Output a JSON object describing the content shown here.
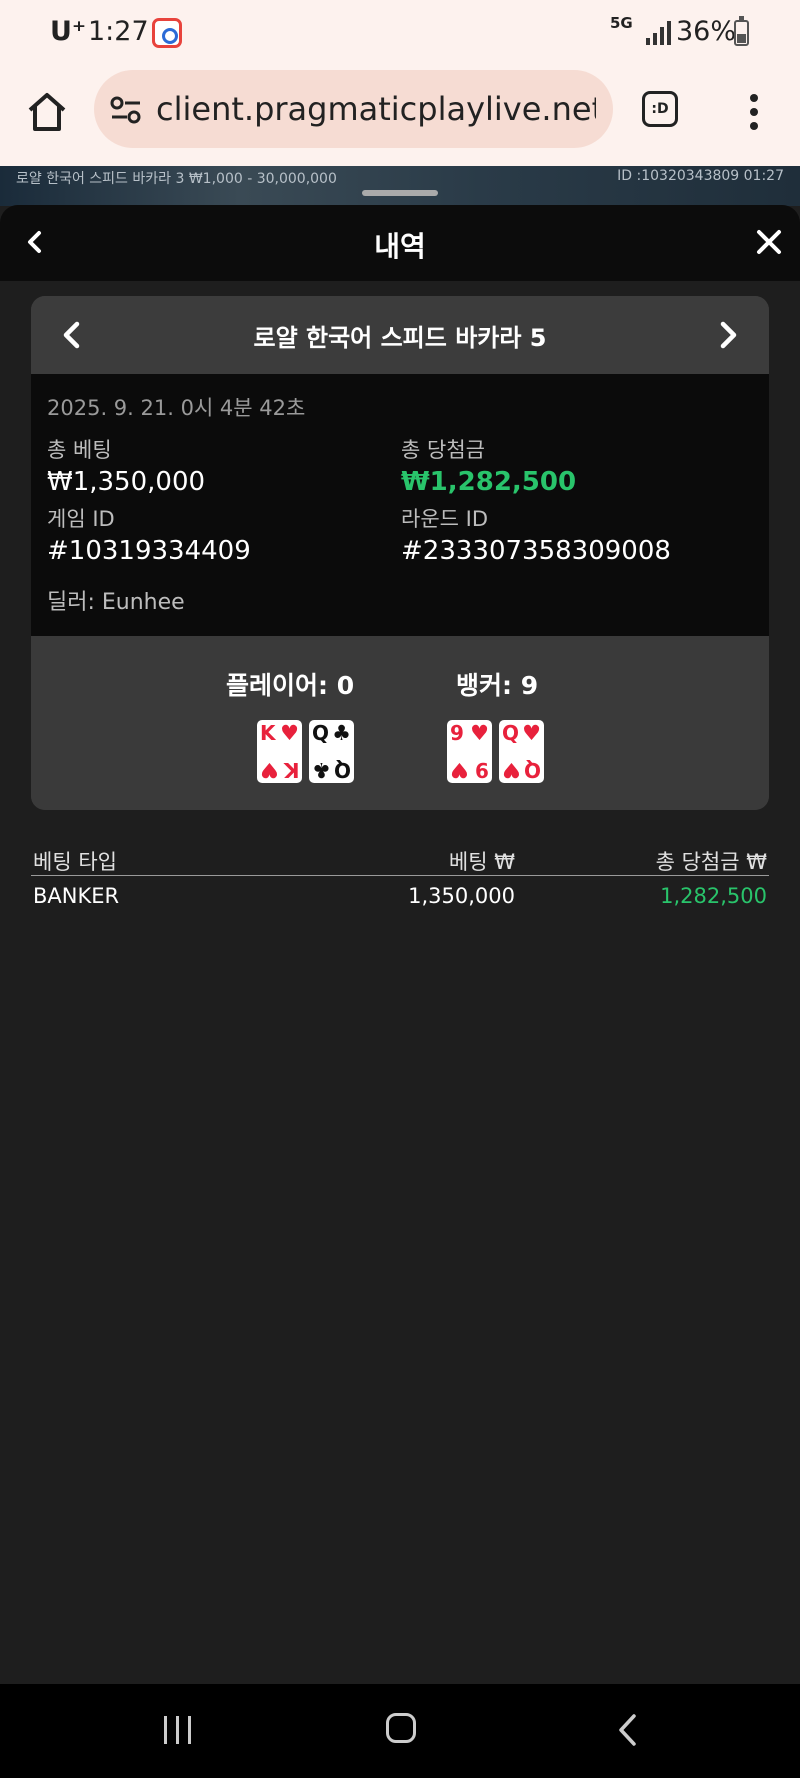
{
  "status_bar": {
    "carrier": "U⁺",
    "time": "1:27",
    "network": "5G",
    "battery": "36%"
  },
  "browser": {
    "url": "client.pragmaticplaylive.net/c",
    "tabs_label": ":D"
  },
  "background_game": {
    "table_text": "로얄 한국어 스피드 바카라 3 ₩1,000 - 30,000,000",
    "id_text": "ID :10320343809 01:27"
  },
  "sheet": {
    "title": "내역"
  },
  "round": {
    "table_name": "로얄 한국어 스피드 바카라 5",
    "datetime": "2025. 9. 21. 0시 4분 42초",
    "total_bet_label": "총 베팅",
    "total_bet_value": "₩1,350,000",
    "total_win_label": "총 당첨금",
    "total_win_value": "₩1,282,500",
    "game_id_label": "게임 ID",
    "game_id_value": "#10319334409",
    "round_id_label": "라운드 ID",
    "round_id_value": "#233307358309008",
    "dealer": "딜러: Eunhee",
    "player_label": "플레이어: 0",
    "banker_label": "뱅커: 9",
    "player_cards": [
      {
        "rank": "K",
        "suit": "♥",
        "color": "red"
      },
      {
        "rank": "Q",
        "suit": "♣",
        "color": "black"
      }
    ],
    "banker_cards": [
      {
        "rank": "9",
        "suit": "♥",
        "color": "red"
      },
      {
        "rank": "Q",
        "suit": "♥",
        "color": "red"
      }
    ]
  },
  "bets": {
    "headers": {
      "type": "베팅 타입",
      "bet": "베팅 ₩",
      "win": "총 당첨금 ₩"
    },
    "rows": [
      {
        "type": "BANKER",
        "bet": "1,350,000",
        "win": "1,282,500"
      }
    ]
  },
  "colors": {
    "win_green": "#29c46b",
    "card_red": "#e8213c",
    "sheet_bg": "#1e1e1e",
    "browser_bg": "#fdf2ee"
  }
}
